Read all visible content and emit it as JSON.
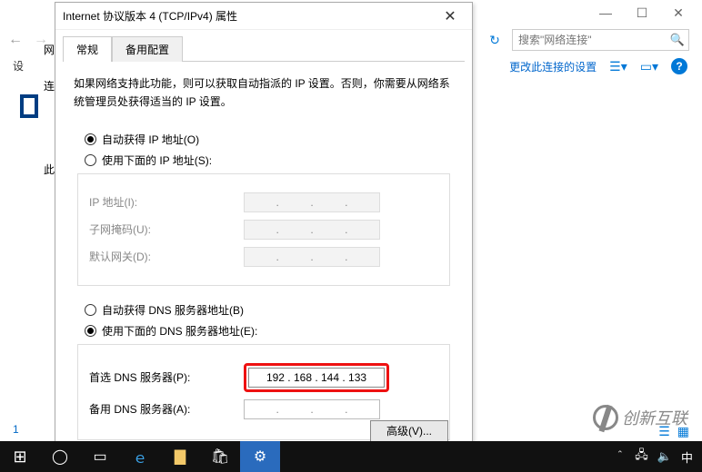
{
  "bg": {
    "win_min": "—",
    "win_max": "☐",
    "win_close": "✕",
    "search_placeholder": "搜索\"网络连接\"",
    "ribbon_link": "更改此连接的设置",
    "left_col2": "设",
    "tab_net": "网络",
    "row_conn": "连",
    "row_this": "此",
    "pagenum": "1"
  },
  "dialog": {
    "title": "Internet 协议版本 4 (TCP/IPv4) 属性",
    "close": "✕",
    "tabs": {
      "general": "常规",
      "alt": "备用配置"
    },
    "desc": "如果网络支持此功能，则可以获取自动指派的 IP 设置。否则，你需要从网络系统管理员处获得适当的 IP 设置。",
    "ip_auto": "自动获得 IP 地址(O)",
    "ip_manual": "使用下面的 IP 地址(S):",
    "ip_addr_label": "IP 地址(I):",
    "subnet_label": "子网掩码(U):",
    "gateway_label": "默认网关(D):",
    "dns_auto": "自动获得 DNS 服务器地址(B)",
    "dns_manual": "使用下面的 DNS 服务器地址(E):",
    "dns_pref_label": "首选 DNS 服务器(P):",
    "dns_pref_value": "192 . 168 . 144 . 133",
    "dns_alt_label": "备用 DNS 服务器(A):",
    "adv_btn": "高级(V)..."
  },
  "watermark": "创新互联",
  "taskbar": {
    "time_chevron": "＾"
  }
}
